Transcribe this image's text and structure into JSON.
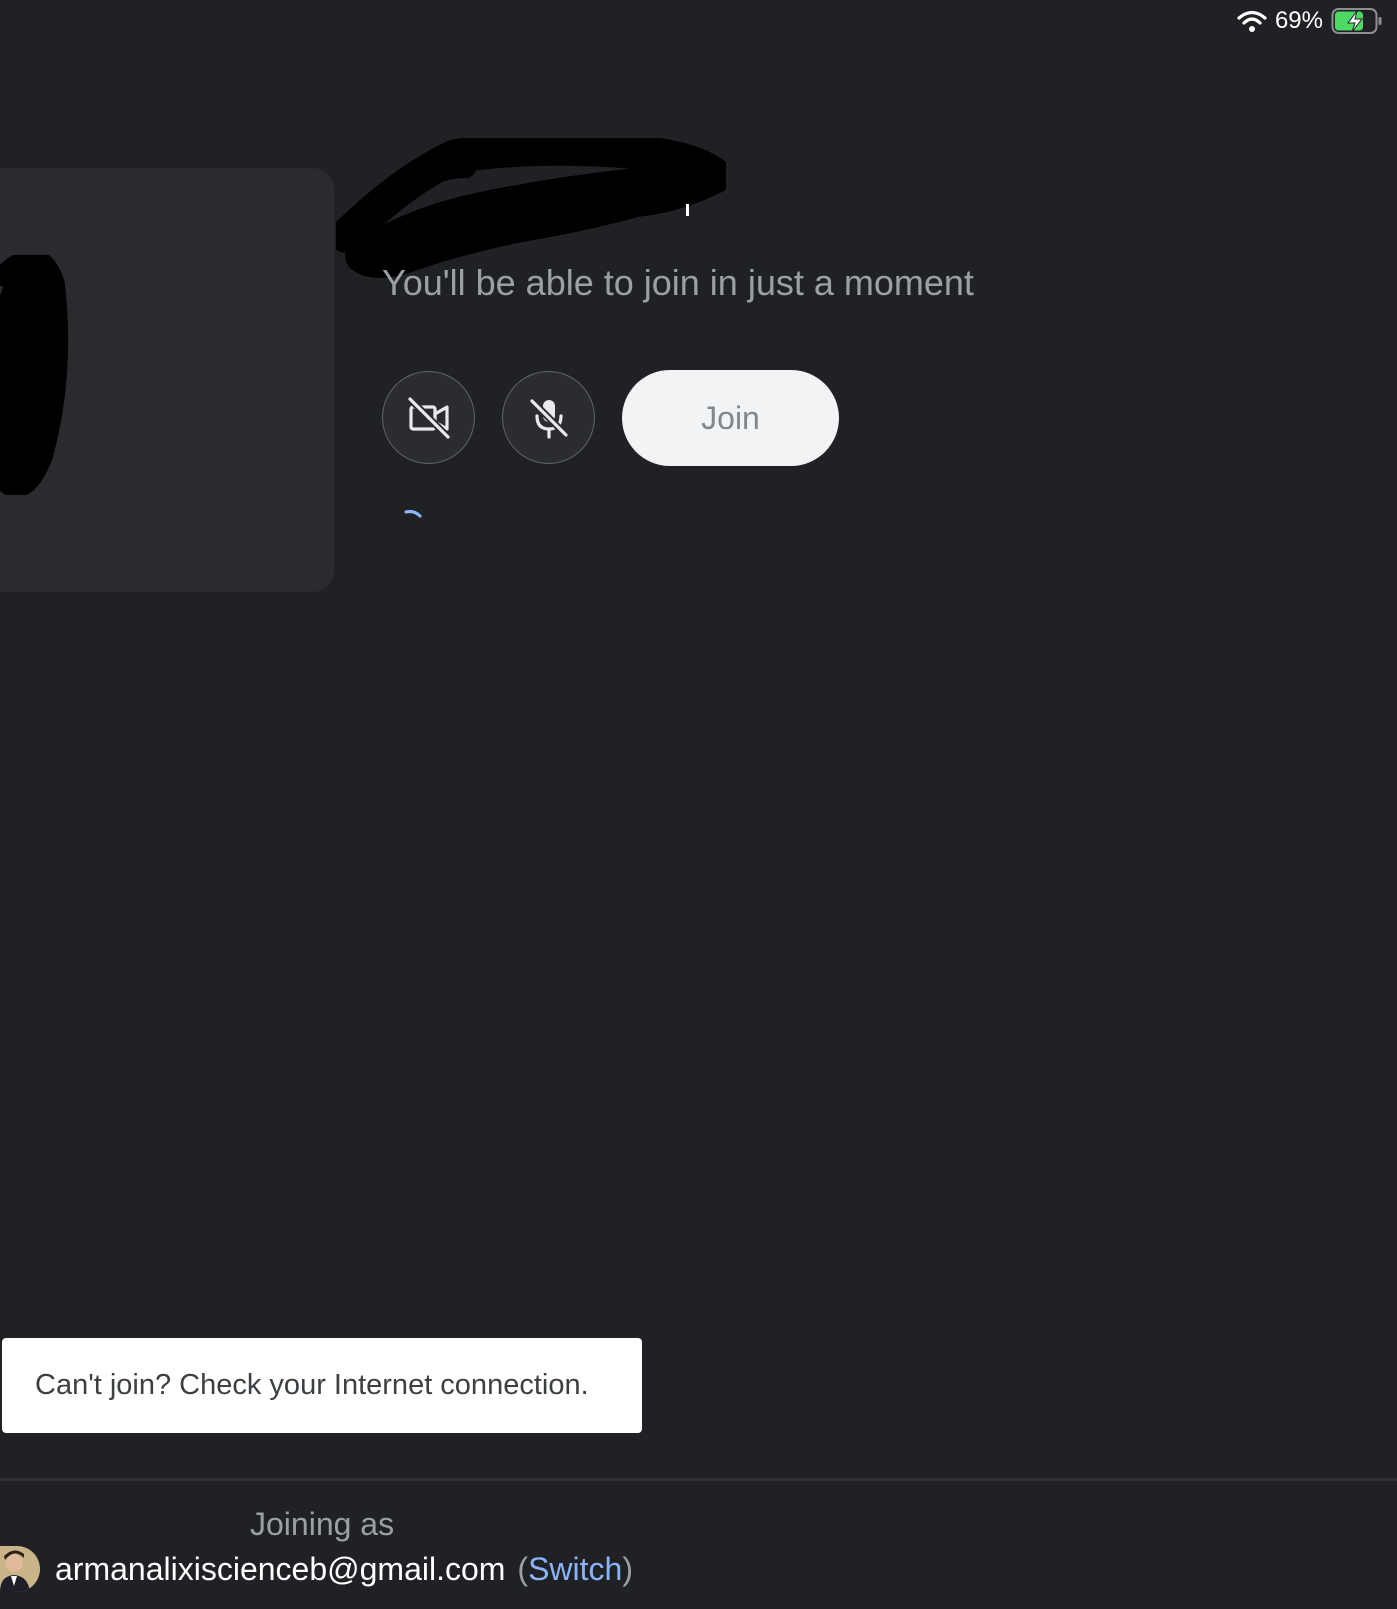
{
  "status_bar": {
    "battery_percent": "69%",
    "charging": true,
    "icons": [
      "wifi-icon",
      "battery-charging-icon"
    ]
  },
  "pre_join": {
    "status_message": "You'll be able to join in just a moment",
    "camera_state": "off",
    "mic_state": "off",
    "join_label": "Join",
    "loading": true
  },
  "snackbar": {
    "message": "Can't join? Check your Internet connection."
  },
  "footer": {
    "joining_as_label": "Joining as",
    "email": "armanalixiscienceb@gmail.com",
    "open_paren": "(",
    "switch_label": "Switch",
    "close_paren": ")"
  },
  "colors": {
    "background": "#202124",
    "card": "#2a2b2e",
    "accent_link": "#8ab4f8",
    "join_button_bg": "#f1f3f4",
    "battery_fill": "#4cd964"
  }
}
